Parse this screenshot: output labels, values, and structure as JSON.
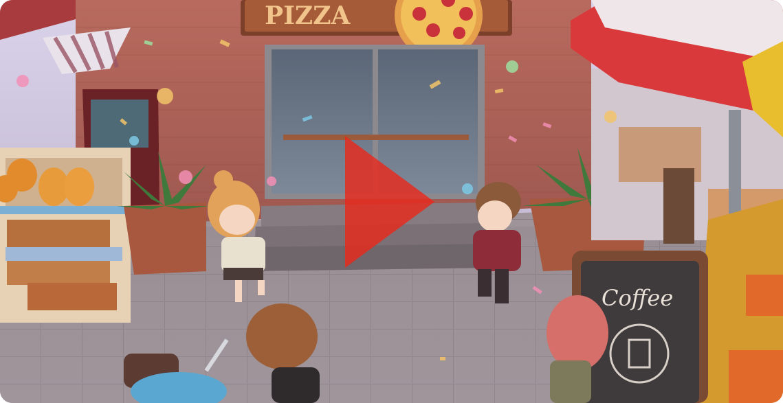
{
  "video": {
    "shop_sign": "PIZZA",
    "chalkboard_text": "Coffee",
    "play_icon": "play-icon",
    "accent_color": "#e8291c"
  }
}
